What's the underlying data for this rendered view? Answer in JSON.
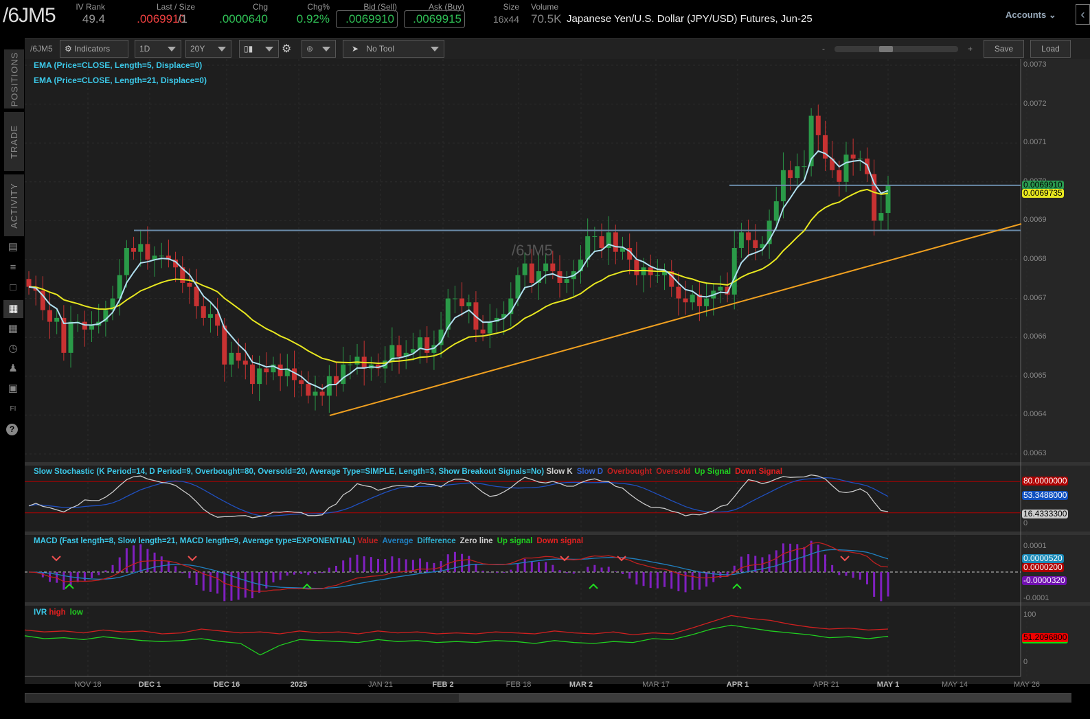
{
  "header": {
    "symbol": "/6JM5",
    "iv_rank_label": "IV Rank",
    "iv_rank": "49.4",
    "last_label": "Last / Size",
    "last": ".0069910",
    "last_size": "/1",
    "chg_label": "Chg",
    "chg": ".0000640",
    "chgpct_label": "Chg%",
    "chgpct": "0.92%",
    "bid_label": "Bid (Sell)",
    "bid": ".0069910",
    "ask_label": "Ask (Buy)",
    "ask": ".0069915",
    "size_label": "Size",
    "size": "16x44",
    "volume_label": "Volume",
    "volume": "70.5K",
    "description": "Japanese Yen/U.S. Dollar (JPY/USD) Futures, Jun-25",
    "accounts": "Accounts"
  },
  "toolbar": {
    "symbol": "/6JM5",
    "indicators": "Indicators",
    "aggregation": "1D",
    "range": "20Y",
    "tool": "No Tool",
    "zoom_minus": "-",
    "zoom_plus": "+",
    "save": "Save",
    "load": "Load"
  },
  "sidebar": {
    "tabs": [
      "POSITIONS",
      "TRADE",
      "ACTIVITY"
    ]
  },
  "price_panel": {
    "watermark": "/6JM5",
    "ema5_label": "EMA (Price=CLOSE, Length=5, Displace=0)",
    "ema21_label": "EMA (Price=CLOSE, Length=21, Displace=0)",
    "axis": [
      "0.0073",
      "0.0072",
      "0.0071",
      "0.0070",
      "0.0069",
      "0.0068",
      "0.0067",
      "0.0066",
      "0.0065",
      "0.0064",
      "0.0063"
    ],
    "last_tag": "0.0069910",
    "ema_tag": "0.0069735",
    "levels": [
      0.006875,
      0.006991
    ]
  },
  "stoch_panel": {
    "title": "Slow Stochastic (K Period=14, D Period=9, Overbought=80, Oversold=20, Average Type=SIMPLE, Length=3, Show Breakout Signals=No)",
    "legend": [
      {
        "t": "Slow K",
        "c": "#cccccc"
      },
      {
        "t": "Slow D",
        "c": "#3060d0"
      },
      {
        "t": "Overbought",
        "c": "#c02020"
      },
      {
        "t": "Oversold",
        "c": "#c02020"
      },
      {
        "t": "Up Signal",
        "c": "#20d020"
      },
      {
        "t": "Down Signal",
        "c": "#e02020"
      }
    ],
    "tags": [
      "80.0000000",
      "53.3488000",
      "16.4333300"
    ],
    "axis": [
      "0"
    ]
  },
  "macd_panel": {
    "title": "MACD (Fast length=8, Slow length=21, MACD length=9, Average type=EXPONENTIAL)",
    "legend": [
      {
        "t": "Value",
        "c": "#c02020"
      },
      {
        "t": "Average",
        "c": "#2080c0"
      },
      {
        "t": "Difference",
        "c": "#30b0d0"
      },
      {
        "t": "Zero line",
        "c": "#cccccc"
      },
      {
        "t": "Up signal",
        "c": "#20d020"
      },
      {
        "t": "Down signal",
        "c": "#e02020"
      }
    ],
    "tags": [
      "0.0000520",
      "0.0000200",
      "-0.0000320"
    ],
    "axis": [
      "0.0001",
      "-0.0001"
    ]
  },
  "ivr_panel": {
    "title": "IVR",
    "legend": [
      {
        "t": "high",
        "c": "#e02020"
      },
      {
        "t": "low",
        "c": "#20d020"
      }
    ],
    "tag": "51.2096800",
    "axis": [
      "100",
      "0"
    ]
  },
  "date_axis": [
    "NOV 18",
    "DEC 1",
    "DEC 16",
    "2025",
    "JAN 21",
    "FEB 2",
    "FEB 18",
    "MAR 2",
    "MAR 17",
    "APR 1",
    "APR 21",
    "MAY 1",
    "MAY 14",
    "MAY 26"
  ],
  "chart_data": {
    "type": "candlestick",
    "symbol": "/6JM5",
    "ylim": [
      0.0063,
      0.0073
    ],
    "closes": [
      0.00673,
      0.00672,
      0.00667,
      0.00664,
      0.00665,
      0.00656,
      0.00664,
      0.00664,
      0.00662,
      0.00663,
      0.00664,
      0.00667,
      0.0067,
      0.00676,
      0.00683,
      0.00682,
      0.00684,
      0.0068,
      0.00681,
      0.00681,
      0.0068,
      0.00678,
      0.00674,
      0.00673,
      0.00668,
      0.00665,
      0.00666,
      0.00663,
      0.00653,
      0.00656,
      0.00654,
      0.00653,
      0.00648,
      0.00652,
      0.00651,
      0.00653,
      0.0065,
      0.00652,
      0.00649,
      0.00648,
      0.00645,
      0.00646,
      0.00645,
      0.0065,
      0.00648,
      0.00653,
      0.00653,
      0.00655,
      0.00652,
      0.00653,
      0.00652,
      0.00654,
      0.00658,
      0.00655,
      0.00656,
      0.00657,
      0.0066,
      0.00656,
      0.00658,
      0.00662,
      0.0067,
      0.0067,
      0.00668,
      0.00669,
      0.00662,
      0.00661,
      0.00664,
      0.00665,
      0.00666,
      0.0067,
      0.00676,
      0.00679,
      0.00674,
      0.00677,
      0.00679,
      0.00677,
      0.00674,
      0.00675,
      0.00677,
      0.0068,
      0.00686,
      0.00686,
      0.00683,
      0.00687,
      0.00682,
      0.00683,
      0.0068,
      0.00676,
      0.00678,
      0.00676,
      0.00676,
      0.00677,
      0.00673,
      0.0067,
      0.00669,
      0.00671,
      0.00668,
      0.0067,
      0.00672,
      0.00673,
      0.00671,
      0.00683,
      0.00687,
      0.00685,
      0.00683,
      0.00684,
      0.0069,
      0.00695,
      0.00703,
      0.00701,
      0.00704,
      0.00704,
      0.00717,
      0.00712,
      0.00706,
      0.00703,
      0.007,
      0.00707,
      0.00706,
      0.00706,
      0.00702,
      0.0069,
      0.00692,
      0.006991
    ],
    "ivr_high": [
      68,
      64,
      66,
      62,
      68,
      64,
      66,
      60,
      62,
      70,
      66,
      62,
      64,
      60,
      66,
      62,
      64,
      60,
      66,
      62,
      64,
      60,
      62,
      60,
      64,
      62,
      60,
      66,
      62,
      60,
      64,
      58,
      62,
      60,
      72,
      85,
      98,
      92,
      88,
      80,
      74,
      70,
      72,
      68,
      70
    ],
    "ivr_low": [
      56,
      50,
      52,
      48,
      54,
      50,
      46,
      44,
      46,
      50,
      44,
      40,
      16,
      36,
      48,
      46,
      44,
      42,
      48,
      44,
      46,
      42,
      44,
      42,
      46,
      44,
      40,
      46,
      42,
      40,
      44,
      42,
      50,
      48,
      58,
      70,
      78,
      72,
      66,
      62,
      58,
      52,
      54,
      50,
      55
    ],
    "trendline": [
      [
        0.0064,
        "2025-01-10"
      ],
      [
        0.00689,
        "2025-05-30"
      ]
    ]
  }
}
